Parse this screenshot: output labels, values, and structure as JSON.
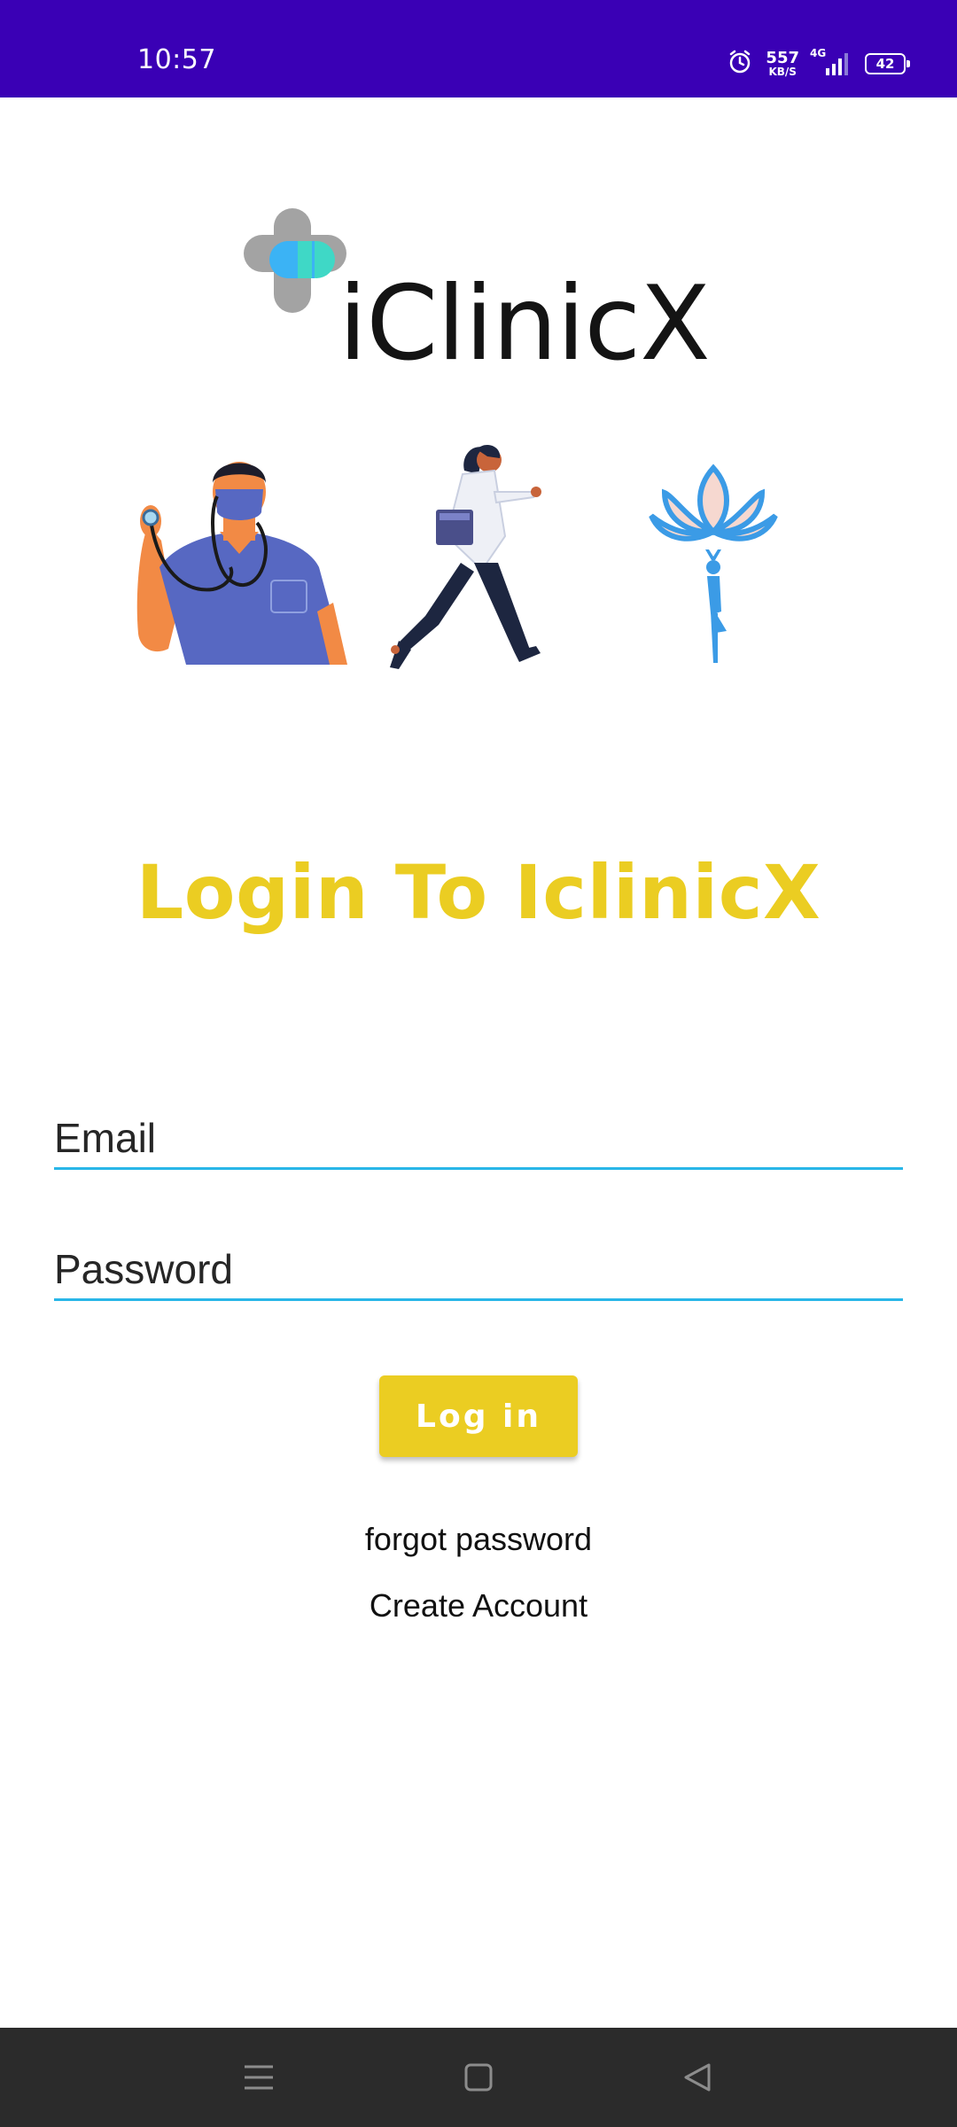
{
  "status_bar": {
    "time": "10:57",
    "net_speed_value": "557",
    "net_speed_unit": "KB/S",
    "network_type": "4G",
    "battery": "42"
  },
  "logo": {
    "text": "iClinicX",
    "icon": "medical-cross-icon"
  },
  "illustrations": [
    "doctor-with-stethoscope",
    "running-doctor",
    "lotus-yoga"
  ],
  "title": "Login To IclinicX",
  "form": {
    "email_placeholder": "Email",
    "password_placeholder": "Password",
    "login_label": "Log in"
  },
  "links": {
    "forgot_password": "forgot password",
    "create_account": "Create Account"
  },
  "nav_bar": {
    "icons": [
      "menu-icon",
      "home-icon",
      "back-icon"
    ]
  },
  "colors": {
    "status_bar": "#3a00b5",
    "accent_yellow": "#ebcd22",
    "input_underline": "#29b6e8",
    "nav_bar": "#2b2b2b"
  }
}
